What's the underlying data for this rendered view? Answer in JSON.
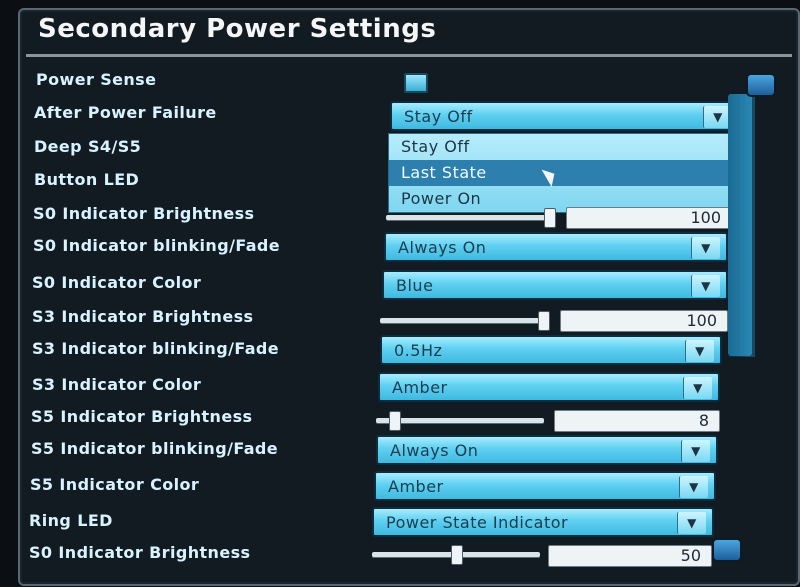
{
  "title": "Secondary Power Settings",
  "colors": {
    "accent": "#2d80ad",
    "field": "#5fd0f0",
    "label": "#d8f2ff"
  },
  "rows": {
    "power_sense": {
      "label": "Power Sense",
      "checked": true
    },
    "after_power_failure": {
      "label": "After Power Failure",
      "value": "Stay Off"
    },
    "deep_s4s5": {
      "label": "Deep S4/S5"
    },
    "button_led": {
      "label": "Button LED"
    },
    "s0_brightness": {
      "label": "S0 Indicator Brightness",
      "value": "100",
      "level_percent": 100
    },
    "s0_blink": {
      "label": "S0 Indicator blinking/Fade",
      "value": "Always On"
    },
    "s0_color": {
      "label": "S0 Indicator Color",
      "value": "Blue"
    },
    "s3_brightness": {
      "label": "S3 Indicator Brightness",
      "value": "100",
      "level_percent": 100
    },
    "s3_blink": {
      "label": "S3 Indicator blinking/Fade",
      "value": "0.5Hz"
    },
    "s3_color": {
      "label": "S3 Indicator Color",
      "value": "Amber"
    },
    "s5_brightness": {
      "label": "S5 Indicator Brightness",
      "value": "8",
      "level_percent": 8
    },
    "s5_blink": {
      "label": "S5 Indicator blinking/Fade",
      "value": "Always On"
    },
    "s5_color": {
      "label": "S5 Indicator Color",
      "value": "Amber"
    },
    "ring_led": {
      "label": "Ring LED",
      "value": "Power State Indicator"
    },
    "s0_brightness_2": {
      "label": "S0 Indicator Brightness",
      "value": "50",
      "level_percent": 50
    }
  },
  "dropdown": {
    "options": [
      "Stay Off",
      "Last State",
      "Power On"
    ],
    "highlighted": "Last State"
  },
  "icons": {
    "arrow": "chevron-down-icon"
  }
}
